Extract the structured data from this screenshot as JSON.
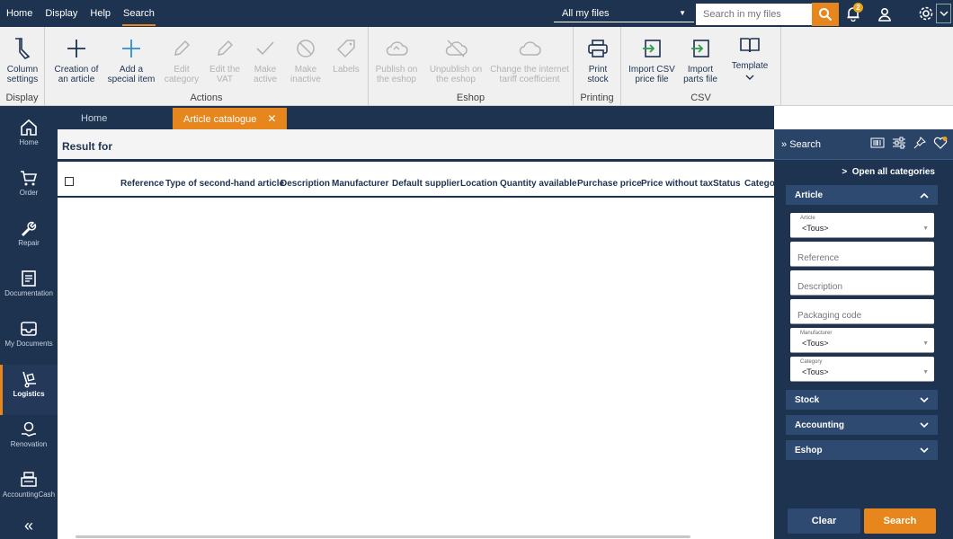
{
  "menu": {
    "items": [
      "Home",
      "Display",
      "Help",
      "Search"
    ],
    "active_index": 3
  },
  "header": {
    "file_selector": "All my files",
    "search_placeholder": "Search in my files",
    "notifications_count": "2"
  },
  "ribbon": {
    "groups": {
      "display": "Display",
      "actions": "Actions",
      "eshop": "Eshop",
      "printing": "Printing",
      "csv": "CSV"
    },
    "buttons": {
      "column_settings": "Column settings",
      "creation_article": "Creation of an article",
      "add_special": "Add a special item",
      "edit_category": "Edit category",
      "edit_vat": "Edit the VAT",
      "make_active": "Make active",
      "make_inactive": "Make inactive",
      "labels": "Labels",
      "publish": "Publish on the eshop",
      "unpublish": "Unpublish on the eshop",
      "tariff": "Change the internet tariff coefficient",
      "print_stock": "Print stock",
      "import_csv": "Import CSV price file",
      "import_parts": "Import parts file",
      "template": "Template"
    }
  },
  "sidebar": {
    "items": [
      "Home",
      "Order",
      "Repair",
      "Documentation",
      "My Documents",
      "Logistics",
      "Renovation",
      "AccountingCash"
    ],
    "active_index": 5
  },
  "tabs": [
    "Home",
    "Article catalogue"
  ],
  "main": {
    "result_title": "Result for",
    "columns": [
      "Reference",
      "Type of second-hand article",
      "Description",
      "Manufacturer",
      "Default supplier",
      "Location",
      "Quantity available",
      "Purchase price",
      "Price without tax",
      "Status",
      "Category"
    ]
  },
  "search_panel": {
    "title": "Search",
    "open_all": "Open all categories",
    "sections": [
      "Article",
      "Stock",
      "Accounting",
      "Eshop"
    ],
    "fields": {
      "article_label": "Article",
      "article_value": "<Tous>",
      "reference": "Reference",
      "description": "Description",
      "packaging": "Packaging code",
      "manufacturer_label": "Manufacturer",
      "manufacturer_value": "<Tous>",
      "category_label": "Category",
      "category_value": "<Tous>"
    },
    "buttons": {
      "clear": "Clear",
      "search": "Search"
    }
  },
  "colors": {
    "navy": "#1e3350",
    "accent": "#e8861e"
  }
}
